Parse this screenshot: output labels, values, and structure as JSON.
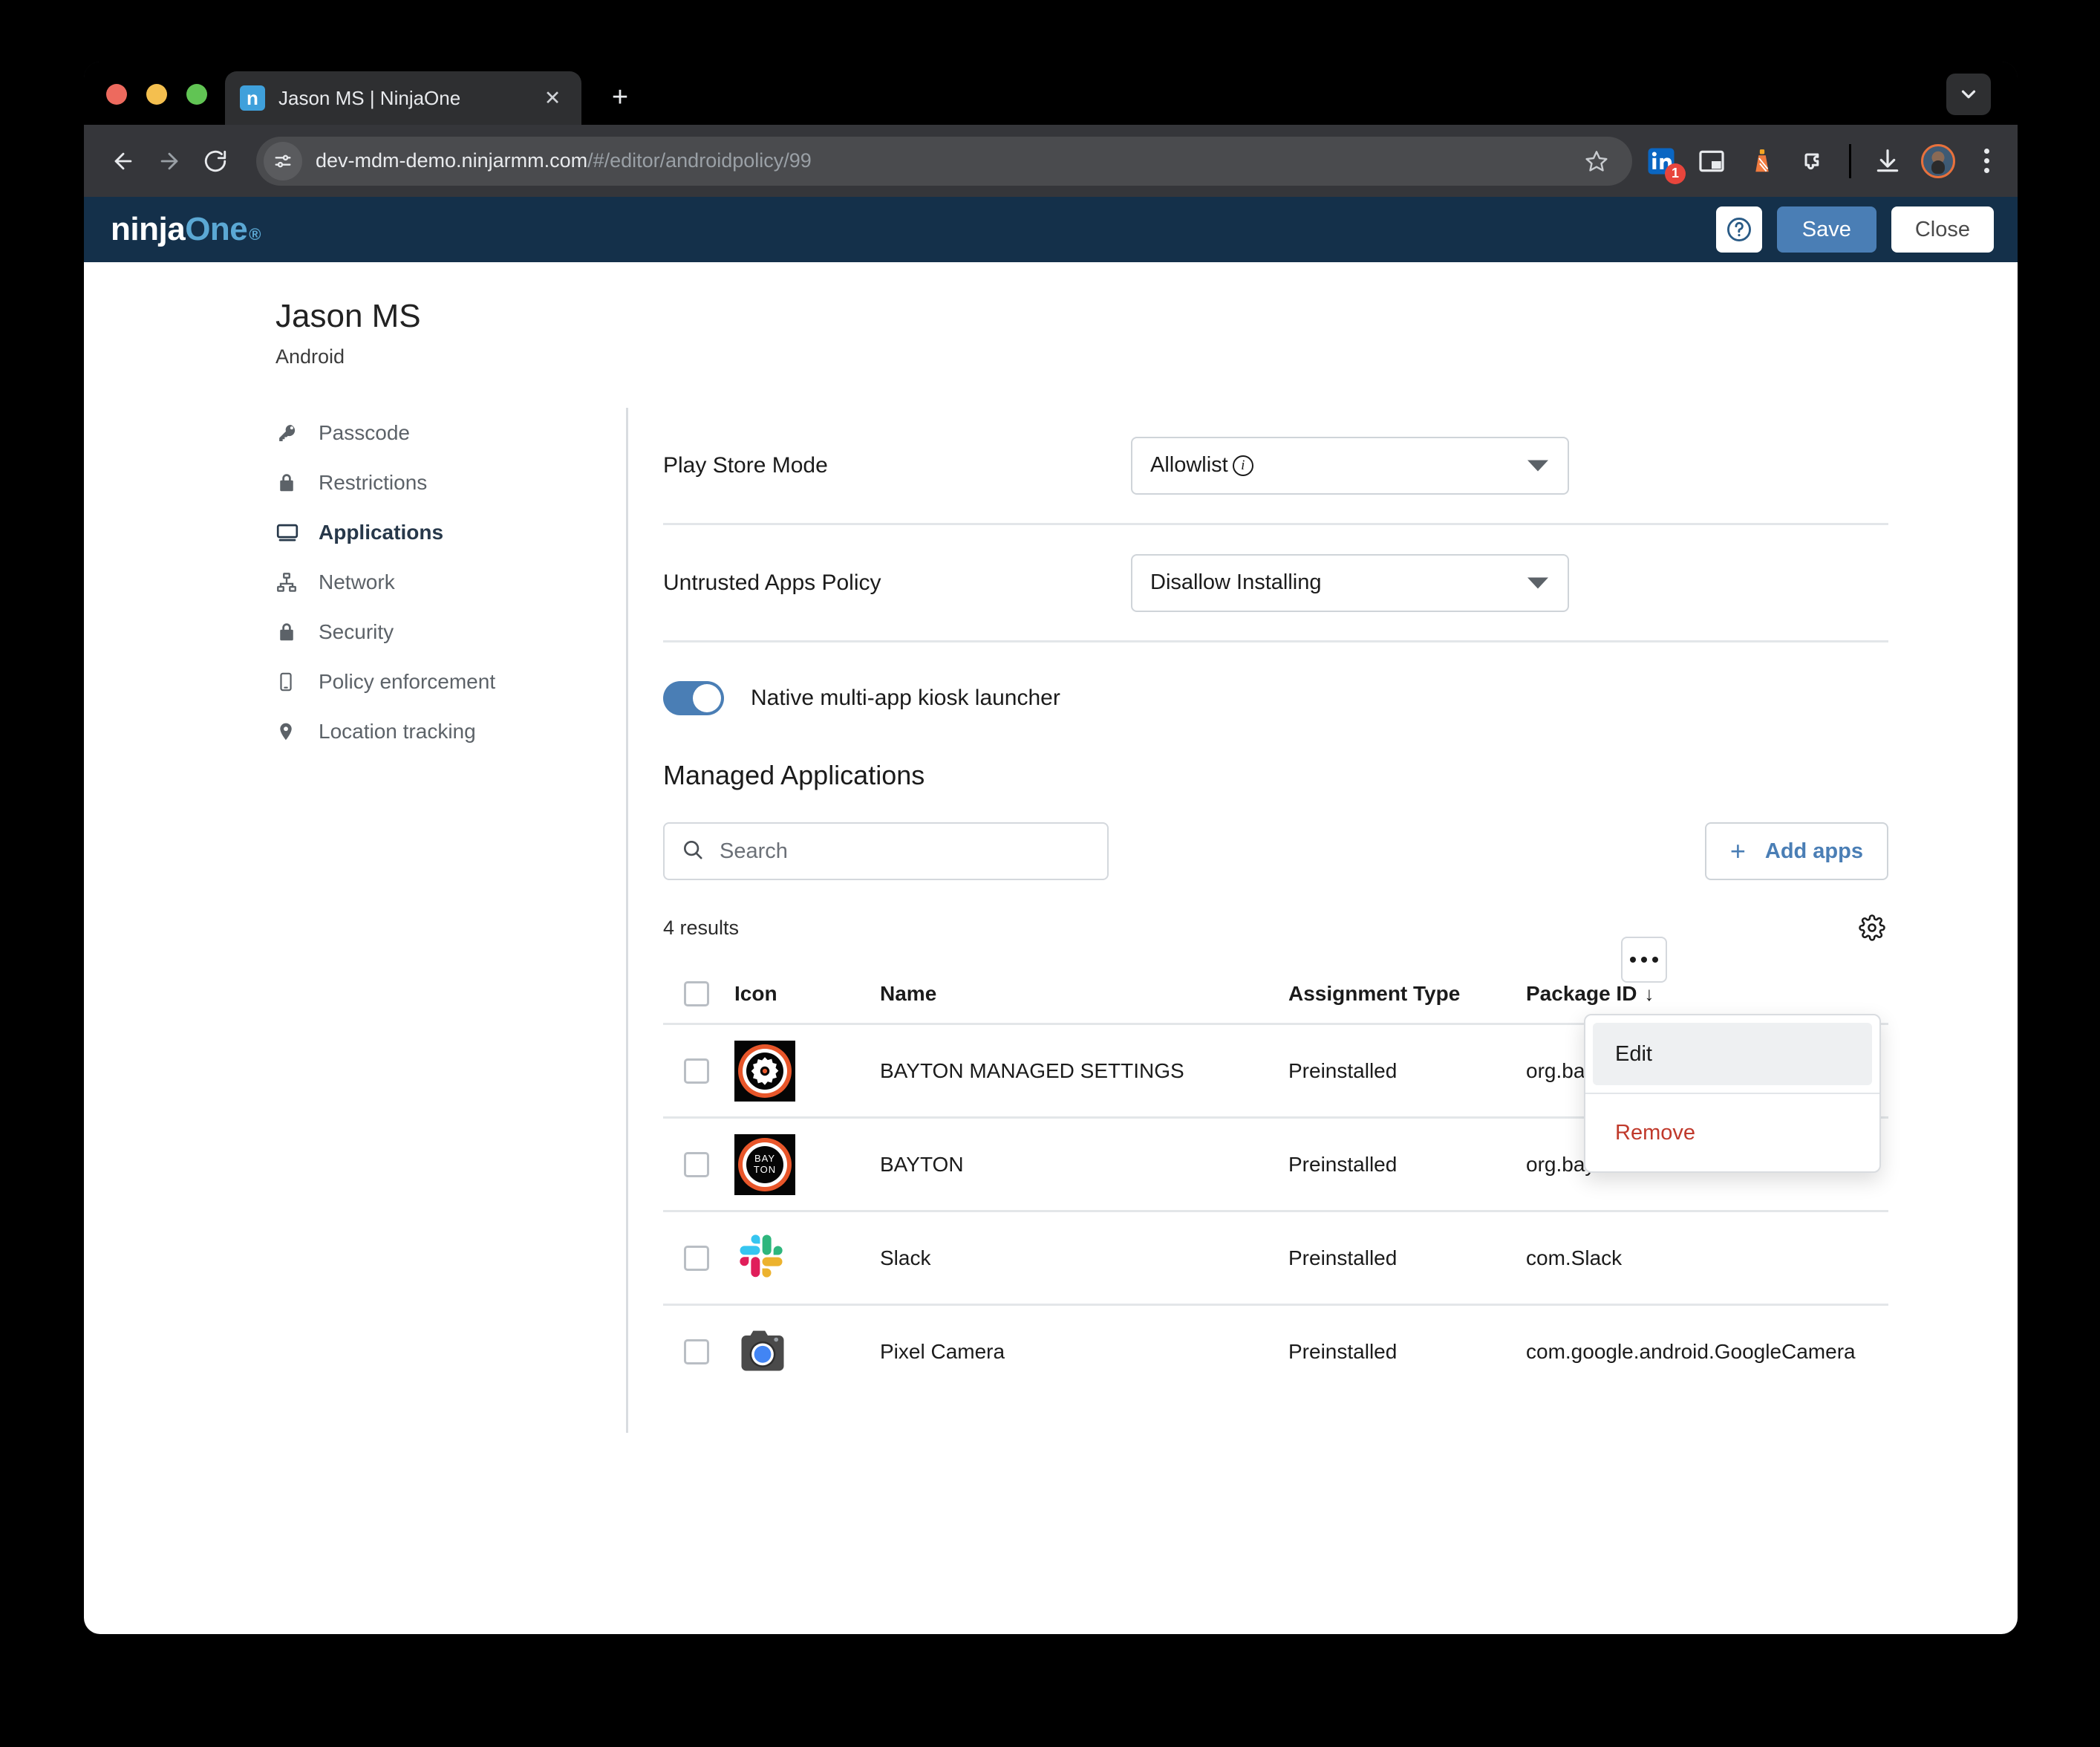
{
  "browser": {
    "tab": {
      "title": "Jason MS | NinjaOne",
      "favicon_letter": "n",
      "close_icon": "close-icon"
    },
    "new_tab_label": "+",
    "omnibox": {
      "host": "dev-mdm-demo.ninjarmm.com",
      "path": "/#/editor/androidpolicy/99"
    },
    "extensions": [
      {
        "name": "linkedin-extension-icon",
        "badge": "1"
      },
      {
        "name": "picture-in-picture-icon",
        "badge": ""
      },
      {
        "name": "lighthouse-extension-icon",
        "badge": ""
      },
      {
        "name": "extensions-puzzle-icon",
        "badge": ""
      }
    ],
    "downloads_icon": "download-icon",
    "profile_icon": "avatar",
    "menu_icon": "chrome-menu-icon"
  },
  "app_header": {
    "logo_primary": "ninja",
    "logo_accent": "One",
    "logo_reg": "®",
    "help_label": "?",
    "save_label": "Save",
    "close_label": "Close",
    "bg_color": "#14304A",
    "save_color": "#4A7EB5"
  },
  "policy": {
    "title": "Jason MS",
    "subtitle": "Android"
  },
  "sidebar": {
    "items": [
      {
        "label": "Passcode",
        "icon": "key-icon",
        "active": false
      },
      {
        "label": "Restrictions",
        "icon": "lock-icon",
        "active": false
      },
      {
        "label": "Applications",
        "icon": "monitor-icon",
        "active": true
      },
      {
        "label": "Network",
        "icon": "network-icon",
        "active": false
      },
      {
        "label": "Security",
        "icon": "lock-icon",
        "active": false
      },
      {
        "label": "Policy enforcement",
        "icon": "phone-icon",
        "active": false
      },
      {
        "label": "Location tracking",
        "icon": "map-pin-icon",
        "active": false
      }
    ]
  },
  "main": {
    "fields": [
      {
        "label": "Play Store Mode",
        "value": "Allowlist",
        "has_info": true
      },
      {
        "label": "Untrusted Apps Policy",
        "value": "Disallow Installing",
        "has_info": false
      }
    ],
    "toggle": {
      "label": "Native multi-app kiosk launcher",
      "on": true
    },
    "section_title": "Managed Applications",
    "search": {
      "placeholder": "Search",
      "value": "",
      "icon": "search-icon"
    },
    "add_apps_label": "Add apps",
    "add_apps_plus": "+",
    "results_text": "4 results",
    "settings_icon": "gear-icon",
    "table": {
      "columns": [
        "Icon",
        "Name",
        "Assignment Type",
        "Package ID"
      ],
      "sort_column": "Package ID",
      "sort_arrow": "↓",
      "rows": [
        {
          "icon": "bayton-settings-icon",
          "name": "BAYTON MANAGED SETTINGS",
          "assignment": "Preinstalled",
          "package_id": "org.bayton.managedsettings",
          "checked": false
        },
        {
          "icon": "bayton-icon",
          "name": "BAYTON",
          "assignment": "Preinstalled",
          "package_id": "org.bayton",
          "checked": false
        },
        {
          "icon": "slack-icon",
          "name": "Slack",
          "assignment": "Preinstalled",
          "package_id": "com.Slack",
          "checked": false
        },
        {
          "icon": "pixel-camera-icon",
          "name": "Pixel Camera",
          "assignment": "Preinstalled",
          "package_id": "com.google.android.GoogleCamera",
          "checked": false
        }
      ]
    },
    "row_menu": {
      "trigger_icon": "more-options-icon",
      "items": [
        {
          "label": "Edit",
          "danger": false,
          "hovered": true
        },
        {
          "label": "Remove",
          "danger": true,
          "hovered": false
        }
      ]
    }
  }
}
